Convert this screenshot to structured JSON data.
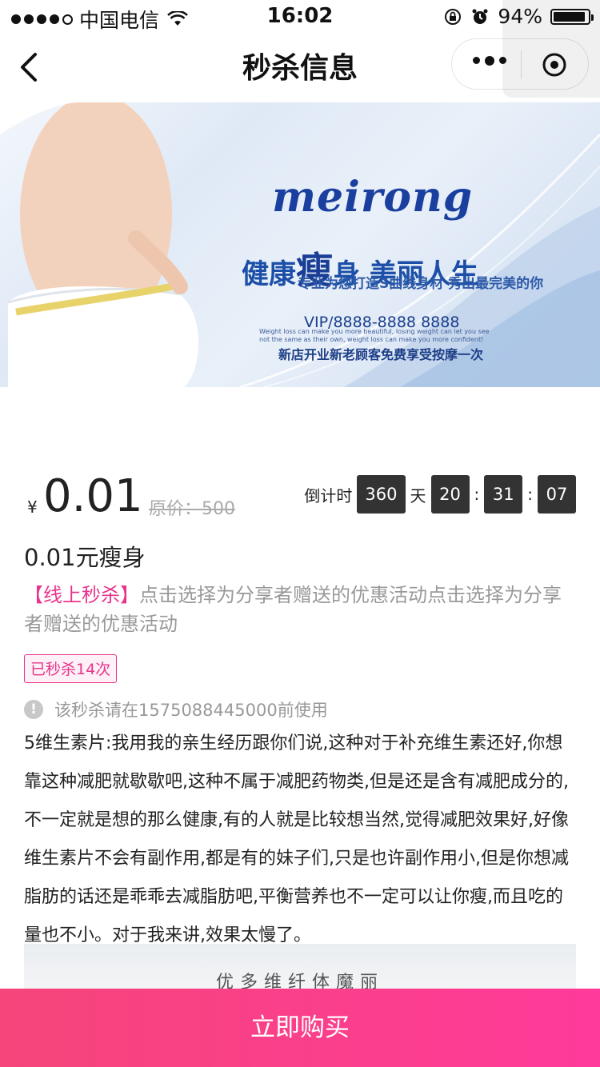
{
  "status_bar": {
    "carrier": "中国电信",
    "time": "16:02",
    "battery": "94%",
    "battery_level": 0.94
  },
  "nav": {
    "title": "秒杀信息"
  },
  "banner": {
    "brand": "meirong",
    "slogan_a": "健康",
    "slogan_big": "瘦",
    "slogan_b": "身  美丽人生",
    "sub_slogan": "专业为您打造S曲线身材  秀出最完美的你",
    "vip": "VIP/8888-8888  8888",
    "tiny_text": "Weight loss can make you more beautiful, losing weight can let you see not the same as their own, weight loss can make you more confident!",
    "promo": "新店开业新老顾客免费享受按摩一次"
  },
  "price": {
    "currency": "¥",
    "value": "0.01",
    "original": "原价：500"
  },
  "countdown": {
    "label": "倒计时",
    "days": "360",
    "day_unit": "天",
    "hours": "20",
    "sep1": ":",
    "minutes": "31",
    "sep2": ":",
    "seconds": "07"
  },
  "product": {
    "title": "0.01元瘦身",
    "tag": "【线上秒杀】",
    "description": "点击选择为分享者赠送的优惠活动点击选择为分享者赠送的优惠活动",
    "sold_badge": "已秒杀14次",
    "notice": "该秒杀请在1575088445000前使用"
  },
  "article": {
    "text": "5维生素片:我用我的亲生经历跟你们说,这种对于补充维生素还好,你想靠这种减肥就歇歇吧,这种不属于减肥药物类,但是还是含有减肥成分的,不一定就是想的那么健康,有的人就是比较想当然,觉得减肥效果好,好像维生素片不会有副作用,都是有的妹子们,只是也许副作用小,但是你想减脂肪的话还是乖乖去减脂肪吧,平衡营养也不一定可以让你瘦,而且吃的量也不小。对于我来讲,效果太慢了。",
    "image_caption": "优多维纤体魔丽"
  },
  "buy_button": "立即购买",
  "colors": {
    "accent": "#e8348b",
    "buy_gradient_start": "#f5457a",
    "buy_gradient_end": "#ff3a9a",
    "countdown_box": "#333333"
  }
}
